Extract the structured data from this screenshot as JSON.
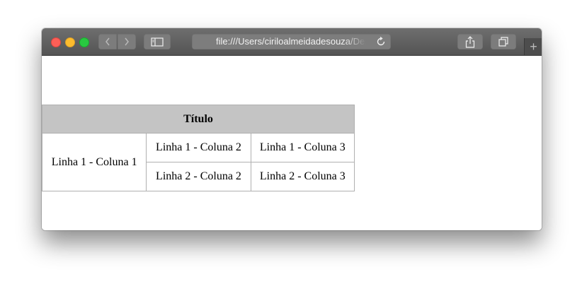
{
  "browser": {
    "address_url": "file:///Users/ciriloalmeidadesouza/Desktop",
    "new_tab_label": "+"
  },
  "table": {
    "title": "Título",
    "rows": [
      [
        "Linha 1 - Coluna 1",
        "Linha 1 - Coluna 2",
        "Linha 1 - Coluna 3"
      ],
      [
        "Linha 2 - Coluna 2",
        "Linha 2 - Coluna 3"
      ]
    ]
  },
  "colors": {
    "header_bg": "#c4c4c4",
    "border": "#b0b0b0",
    "titlebar": "#5f5f5f"
  }
}
